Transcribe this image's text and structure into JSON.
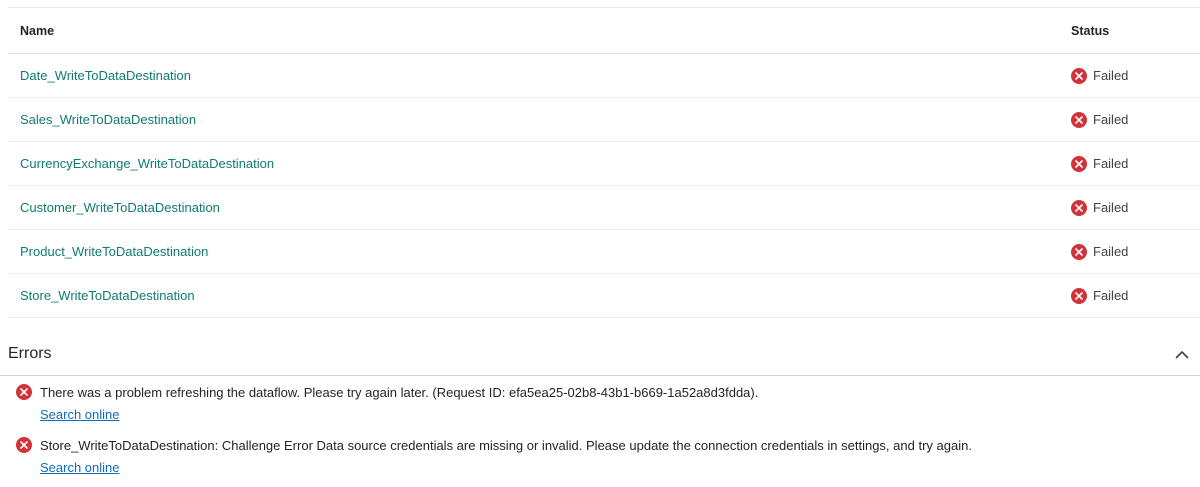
{
  "table": {
    "headers": {
      "name": "Name",
      "status": "Status"
    },
    "rows": [
      {
        "name": "Date_WriteToDataDestination",
        "status": "Failed"
      },
      {
        "name": "Sales_WriteToDataDestination",
        "status": "Failed"
      },
      {
        "name": "CurrencyExchange_WriteToDataDestination",
        "status": "Failed"
      },
      {
        "name": "Customer_WriteToDataDestination",
        "status": "Failed"
      },
      {
        "name": "Product_WriteToDataDestination",
        "status": "Failed"
      },
      {
        "name": "Store_WriteToDataDestination",
        "status": "Failed"
      }
    ]
  },
  "errors": {
    "title": "Errors",
    "items": [
      {
        "message": "There was a problem refreshing the dataflow. Please try again later. (Request ID: efa5ea25-02b8-43b1-b669-1a52a8d3fdda).",
        "link": "Search online"
      },
      {
        "message": "Store_WriteToDataDestination: Challenge Error Data source credentials are missing or invalid. Please update the connection credentials in settings, and try again.",
        "link": "Search online"
      }
    ]
  },
  "colors": {
    "link_teal": "#0f7c6e",
    "link_blue": "#0f6cbd",
    "error_red": "#d13438"
  },
  "icons": {
    "status": "error-circle-icon",
    "collapse": "chevron-up-icon"
  }
}
